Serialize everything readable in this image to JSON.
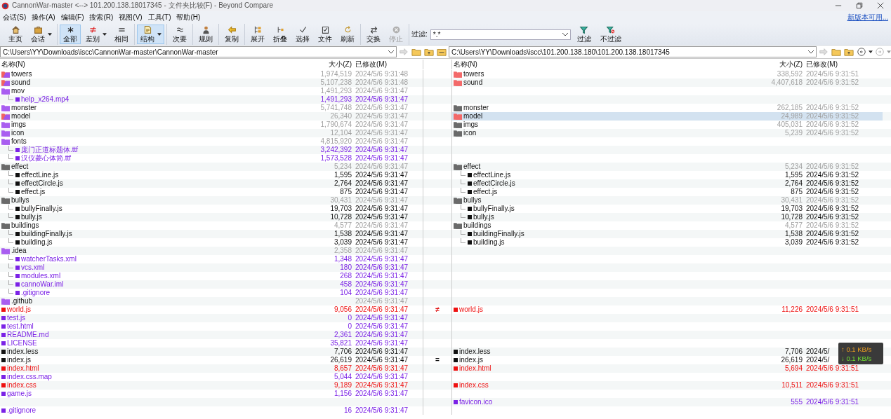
{
  "window": {
    "title": "CannonWar-master <--> 101.200.138.18017345 - 文件夹比较(F) - Beyond Compare"
  },
  "menu": [
    "会话(S)",
    "操作(A)",
    "编辑(F)",
    "搜索(R)",
    "视图(V)",
    "工具(T)",
    "帮助(H)"
  ],
  "update_link": "新版本可用...",
  "toolbar": {
    "groups": [
      [
        {
          "label": "主页",
          "selected": false,
          "has_menu": false,
          "disabled": false
        },
        {
          "label": "会话",
          "selected": false,
          "has_menu": true,
          "disabled": false
        }
      ],
      [
        {
          "label": "全部",
          "selected": true,
          "has_menu": false,
          "disabled": false
        },
        {
          "label": "差别",
          "selected": false,
          "has_menu": true,
          "disabled": false
        },
        {
          "label": "相同",
          "selected": false,
          "has_menu": false,
          "disabled": false
        }
      ],
      [
        {
          "label": "结构",
          "selected": true,
          "has_menu": true,
          "disabled": false
        }
      ],
      [
        {
          "label": "次要",
          "selected": false,
          "has_menu": false,
          "disabled": false
        }
      ],
      [
        {
          "label": "规则",
          "selected": false,
          "has_menu": false,
          "disabled": false
        }
      ],
      [
        {
          "label": "复制",
          "selected": false,
          "has_menu": false,
          "disabled": false
        }
      ],
      [
        {
          "label": "展开",
          "selected": false,
          "has_menu": false,
          "disabled": false
        },
        {
          "label": "折叠",
          "selected": false,
          "has_menu": false,
          "disabled": false
        },
        {
          "label": "选择",
          "selected": false,
          "has_menu": false,
          "disabled": false
        },
        {
          "label": "文件",
          "selected": false,
          "has_menu": false,
          "disabled": false
        },
        {
          "label": "刷新",
          "selected": false,
          "has_menu": false,
          "disabled": false
        }
      ],
      [
        {
          "label": "交换",
          "selected": false,
          "has_menu": false,
          "disabled": false
        },
        {
          "label": "停止",
          "selected": false,
          "has_menu": false,
          "disabled": true
        }
      ]
    ],
    "filter": {
      "label": "过滤:",
      "value": "*.*"
    },
    "filter_buttons": [
      "过滤",
      "不过滤"
    ]
  },
  "paths": {
    "left": "C:\\Users\\YY\\Downloads\\iscc\\CannonWar-master\\CannonWar-master",
    "right": "C:\\Users\\YY\\Downloads\\iscc\\101.200.138.180\\101.200.138.18017345"
  },
  "columns": {
    "left": [
      "名称(N)",
      "大小(Z)",
      "已修改(M)"
    ],
    "right": [
      "名称(N)",
      "大小(Z)",
      "已修改(M)"
    ]
  },
  "rows": [
    {
      "selected": false,
      "left": {
        "name": "towers",
        "kind": "folder",
        "orphan": true,
        "changed": true,
        "size": "1,974,519",
        "modified": "2024/5/6 9:31:48"
      },
      "right": {
        "name": "towers",
        "kind": "folder",
        "orphan": false,
        "changed": true,
        "size": "338,592",
        "modified": "2024/5/6 9:31:51"
      }
    },
    {
      "selected": false,
      "left": {
        "name": "sound",
        "kind": "folder",
        "orphan": true,
        "changed": true,
        "size": "5,107,238",
        "modified": "2024/5/6 9:31:48"
      },
      "right": {
        "name": "sound",
        "kind": "folder",
        "orphan": false,
        "changed": true,
        "size": "4,407,618",
        "modified": "2024/5/6 9:31:52"
      }
    },
    {
      "selected": false,
      "left": {
        "name": "mov",
        "kind": "folder",
        "orphan": true,
        "changed": false,
        "size": "1,491,293",
        "modified": "2024/5/6 9:31:47"
      },
      "children": [
        {
          "selected": false,
          "left": {
            "name": "help_x264.mp4",
            "kind": "file",
            "orphan": true,
            "changed": false,
            "size": "1,491,293",
            "modified": "2024/5/6 9:31:47"
          }
        }
      ]
    },
    {
      "selected": false,
      "left": {
        "name": "monster",
        "kind": "folder",
        "orphan": true,
        "changed": false,
        "size": "5,741,748",
        "modified": "2024/5/6 9:31:47"
      },
      "right": {
        "name": "monster",
        "kind": "folder",
        "orphan": false,
        "changed": false,
        "size": "262,185",
        "modified": "2024/5/6 9:31:52"
      }
    },
    {
      "selected": true,
      "left": {
        "name": "model",
        "kind": "folder",
        "orphan": true,
        "changed": true,
        "size": "26,340",
        "modified": "2024/5/6 9:31:47"
      },
      "right": {
        "name": "model",
        "kind": "folder",
        "orphan": false,
        "changed": true,
        "size": "24,989",
        "modified": "2024/5/6 9:31:52"
      }
    },
    {
      "selected": false,
      "left": {
        "name": "imgs",
        "kind": "folder",
        "orphan": true,
        "changed": false,
        "size": "1,790,674",
        "modified": "2024/5/6 9:31:47"
      },
      "right": {
        "name": "imgs",
        "kind": "folder",
        "orphan": false,
        "changed": false,
        "size": "405,031",
        "modified": "2024/5/6 9:31:52"
      }
    },
    {
      "selected": false,
      "left": {
        "name": "icon",
        "kind": "folder",
        "orphan": true,
        "changed": false,
        "size": "12,104",
        "modified": "2024/5/6 9:31:47"
      },
      "right": {
        "name": "icon",
        "kind": "folder",
        "orphan": false,
        "changed": false,
        "size": "5,239",
        "modified": "2024/5/6 9:31:52"
      }
    },
    {
      "selected": false,
      "left": {
        "name": "fonts",
        "kind": "folder",
        "orphan": true,
        "changed": false,
        "size": "4,815,920",
        "modified": "2024/5/6 9:31:47"
      },
      "children": [
        {
          "selected": false,
          "left": {
            "name": "庞门正道标题体.ttf",
            "kind": "file",
            "orphan": true,
            "changed": false,
            "size": "3,242,392",
            "modified": "2024/5/6 9:31:47"
          }
        },
        {
          "selected": false,
          "left": {
            "name": "汉仪菱心体简.ttf",
            "kind": "file",
            "orphan": true,
            "changed": false,
            "size": "1,573,528",
            "modified": "2024/5/6 9:31:47"
          }
        }
      ]
    },
    {
      "selected": false,
      "left": {
        "name": "effect",
        "kind": "folder",
        "orphan": false,
        "changed": false,
        "size": "5,234",
        "modified": "2024/5/6 9:31:47"
      },
      "right": {
        "name": "effect",
        "kind": "folder",
        "orphan": false,
        "changed": false,
        "size": "5,234",
        "modified": "2024/5/6 9:31:52"
      },
      "children": [
        {
          "selected": false,
          "left": {
            "name": "effectLine.js",
            "kind": "file",
            "orphan": false,
            "changed": false,
            "size": "1,595",
            "modified": "2024/5/6 9:31:47"
          },
          "right": {
            "name": "effectLine.js",
            "kind": "file",
            "orphan": false,
            "changed": false,
            "size": "1,595",
            "modified": "2024/5/6 9:31:52"
          }
        },
        {
          "selected": false,
          "left": {
            "name": "effectCircle.js",
            "kind": "file",
            "orphan": false,
            "changed": false,
            "size": "2,764",
            "modified": "2024/5/6 9:31:47"
          },
          "right": {
            "name": "effectCircle.js",
            "kind": "file",
            "orphan": false,
            "changed": false,
            "size": "2,764",
            "modified": "2024/5/6 9:31:52"
          }
        },
        {
          "selected": false,
          "left": {
            "name": "effect.js",
            "kind": "file",
            "orphan": false,
            "changed": false,
            "size": "875",
            "modified": "2024/5/6 9:31:47"
          },
          "right": {
            "name": "effect.js",
            "kind": "file",
            "orphan": false,
            "changed": false,
            "size": "875",
            "modified": "2024/5/6 9:31:52"
          }
        }
      ]
    },
    {
      "selected": false,
      "left": {
        "name": "bullys",
        "kind": "folder",
        "orphan": false,
        "changed": false,
        "size": "30,431",
        "modified": "2024/5/6 9:31:47"
      },
      "right": {
        "name": "bullys",
        "kind": "folder",
        "orphan": false,
        "changed": false,
        "size": "30,431",
        "modified": "2024/5/6 9:31:52"
      },
      "children": [
        {
          "selected": false,
          "left": {
            "name": "bullyFinally.js",
            "kind": "file",
            "orphan": false,
            "changed": false,
            "size": "19,703",
            "modified": "2024/5/6 9:31:47"
          },
          "right": {
            "name": "bullyFinally.js",
            "kind": "file",
            "orphan": false,
            "changed": false,
            "size": "19,703",
            "modified": "2024/5/6 9:31:52"
          }
        },
        {
          "selected": false,
          "left": {
            "name": "bully.js",
            "kind": "file",
            "orphan": false,
            "changed": false,
            "size": "10,728",
            "modified": "2024/5/6 9:31:47"
          },
          "right": {
            "name": "bully.js",
            "kind": "file",
            "orphan": false,
            "changed": false,
            "size": "10,728",
            "modified": "2024/5/6 9:31:52"
          }
        }
      ]
    },
    {
      "selected": false,
      "left": {
        "name": "buildings",
        "kind": "folder",
        "orphan": false,
        "changed": false,
        "size": "4,577",
        "modified": "2024/5/6 9:31:47"
      },
      "right": {
        "name": "buildings",
        "kind": "folder",
        "orphan": false,
        "changed": false,
        "size": "4,577",
        "modified": "2024/5/6 9:31:52"
      },
      "children": [
        {
          "selected": false,
          "left": {
            "name": "buildingFinally.js",
            "kind": "file",
            "orphan": false,
            "changed": false,
            "size": "1,538",
            "modified": "2024/5/6 9:31:47"
          },
          "right": {
            "name": "buildingFinally.js",
            "kind": "file",
            "orphan": false,
            "changed": false,
            "size": "1,538",
            "modified": "2024/5/6 9:31:52"
          }
        },
        {
          "selected": false,
          "left": {
            "name": "building.js",
            "kind": "file",
            "orphan": false,
            "changed": false,
            "size": "3,039",
            "modified": "2024/5/6 9:31:47"
          },
          "right": {
            "name": "building.js",
            "kind": "file",
            "orphan": false,
            "changed": false,
            "size": "3,039",
            "modified": "2024/5/6 9:31:52"
          }
        }
      ]
    },
    {
      "selected": false,
      "left": {
        "name": ".idea",
        "kind": "folder",
        "orphan": true,
        "changed": false,
        "size": "2,358",
        "modified": "2024/5/6 9:31:47"
      },
      "children": [
        {
          "selected": false,
          "left": {
            "name": "watcherTasks.xml",
            "kind": "file",
            "orphan": true,
            "changed": false,
            "size": "1,348",
            "modified": "2024/5/6 9:31:47"
          }
        },
        {
          "selected": false,
          "left": {
            "name": "vcs.xml",
            "kind": "file",
            "orphan": true,
            "changed": false,
            "size": "180",
            "modified": "2024/5/6 9:31:47"
          }
        },
        {
          "selected": false,
          "left": {
            "name": "modules.xml",
            "kind": "file",
            "orphan": true,
            "changed": false,
            "size": "268",
            "modified": "2024/5/6 9:31:47"
          }
        },
        {
          "selected": false,
          "left": {
            "name": "cannoWar.iml",
            "kind": "file",
            "orphan": true,
            "changed": false,
            "size": "458",
            "modified": "2024/5/6 9:31:47"
          }
        },
        {
          "selected": false,
          "left": {
            "name": ".gitignore",
            "kind": "file",
            "orphan": true,
            "changed": false,
            "size": "104",
            "modified": "2024/5/6 9:31:47"
          }
        }
      ]
    },
    {
      "selected": false,
      "left": {
        "name": ".github",
        "kind": "folder",
        "orphan": true,
        "changed": false,
        "modified": "2024/5/6 9:31:47"
      }
    },
    {
      "selected": false,
      "marker": "≠",
      "left": {
        "name": "world.js",
        "kind": "file",
        "orphan": false,
        "changed": true,
        "size": "9,056",
        "modified": "2024/5/6 9:31:47"
      },
      "right": {
        "name": "world.js",
        "kind": "file",
        "orphan": false,
        "changed": true,
        "size": "11,226",
        "modified": "2024/5/6 9:31:51"
      }
    },
    {
      "selected": false,
      "left": {
        "name": "test.js",
        "kind": "file",
        "orphan": true,
        "changed": false,
        "size": "0",
        "modified": "2024/5/6 9:31:47"
      }
    },
    {
      "selected": false,
      "left": {
        "name": "test.html",
        "kind": "file",
        "orphan": true,
        "changed": false,
        "size": "0",
        "modified": "2024/5/6 9:31:47"
      }
    },
    {
      "selected": false,
      "left": {
        "name": "README.md",
        "kind": "file",
        "orphan": true,
        "changed": false,
        "size": "2,361",
        "modified": "2024/5/6 9:31:47"
      }
    },
    {
      "selected": false,
      "left": {
        "name": "LICENSE",
        "kind": "file",
        "orphan": true,
        "changed": false,
        "size": "35,821",
        "modified": "2024/5/6 9:31:47"
      }
    },
    {
      "selected": false,
      "left": {
        "name": "index.less",
        "kind": "file",
        "orphan": false,
        "changed": false,
        "size": "7,706",
        "modified": "2024/5/6 9:31:47"
      },
      "right": {
        "name": "index.less",
        "kind": "file",
        "orphan": false,
        "changed": false,
        "size": "7,706",
        "modified": "2024/5/"
      }
    },
    {
      "selected": false,
      "marker": "=",
      "left": {
        "name": "index.js",
        "kind": "file",
        "orphan": false,
        "changed": false,
        "size": "26,619",
        "modified": "2024/5/6 9:31:47"
      },
      "right": {
        "name": "index.js",
        "kind": "file",
        "orphan": false,
        "changed": false,
        "size": "26,619",
        "modified": "2024/5/"
      }
    },
    {
      "selected": false,
      "left": {
        "name": "index.html",
        "kind": "file",
        "orphan": false,
        "changed": true,
        "size": "8,657",
        "modified": "2024/5/6 9:31:47"
      },
      "right": {
        "name": "index.html",
        "kind": "file",
        "orphan": false,
        "changed": true,
        "size": "5,694",
        "modified": "2024/5/6 9:31:51"
      }
    },
    {
      "selected": false,
      "left": {
        "name": "index.css.map",
        "kind": "file",
        "orphan": true,
        "changed": false,
        "size": "5,044",
        "modified": "2024/5/6 9:31:47"
      }
    },
    {
      "selected": false,
      "left": {
        "name": "index.css",
        "kind": "file",
        "orphan": false,
        "changed": true,
        "size": "9,189",
        "modified": "2024/5/6 9:31:47"
      },
      "right": {
        "name": "index.css",
        "kind": "file",
        "orphan": false,
        "changed": true,
        "size": "10,511",
        "modified": "2024/5/6 9:31:51"
      }
    },
    {
      "selected": false,
      "left": {
        "name": "game.js",
        "kind": "file",
        "orphan": true,
        "changed": false,
        "size": "1,156",
        "modified": "2024/5/6 9:31:47"
      }
    },
    {
      "selected": false,
      "right": {
        "name": "favicon.ico",
        "kind": "file",
        "orphan": true,
        "changed": false,
        "size": "555",
        "modified": "2024/5/6 9:31:51"
      }
    },
    {
      "selected": false,
      "left": {
        "name": ".gitignore",
        "kind": "file",
        "orphan": true,
        "changed": false,
        "size": "16",
        "modified": "2024/5/6 9:31:47"
      }
    }
  ],
  "net_speed": {
    "up": "↑ 0.1 KB/s",
    "down": "↓ 0.1 KB/s"
  }
}
